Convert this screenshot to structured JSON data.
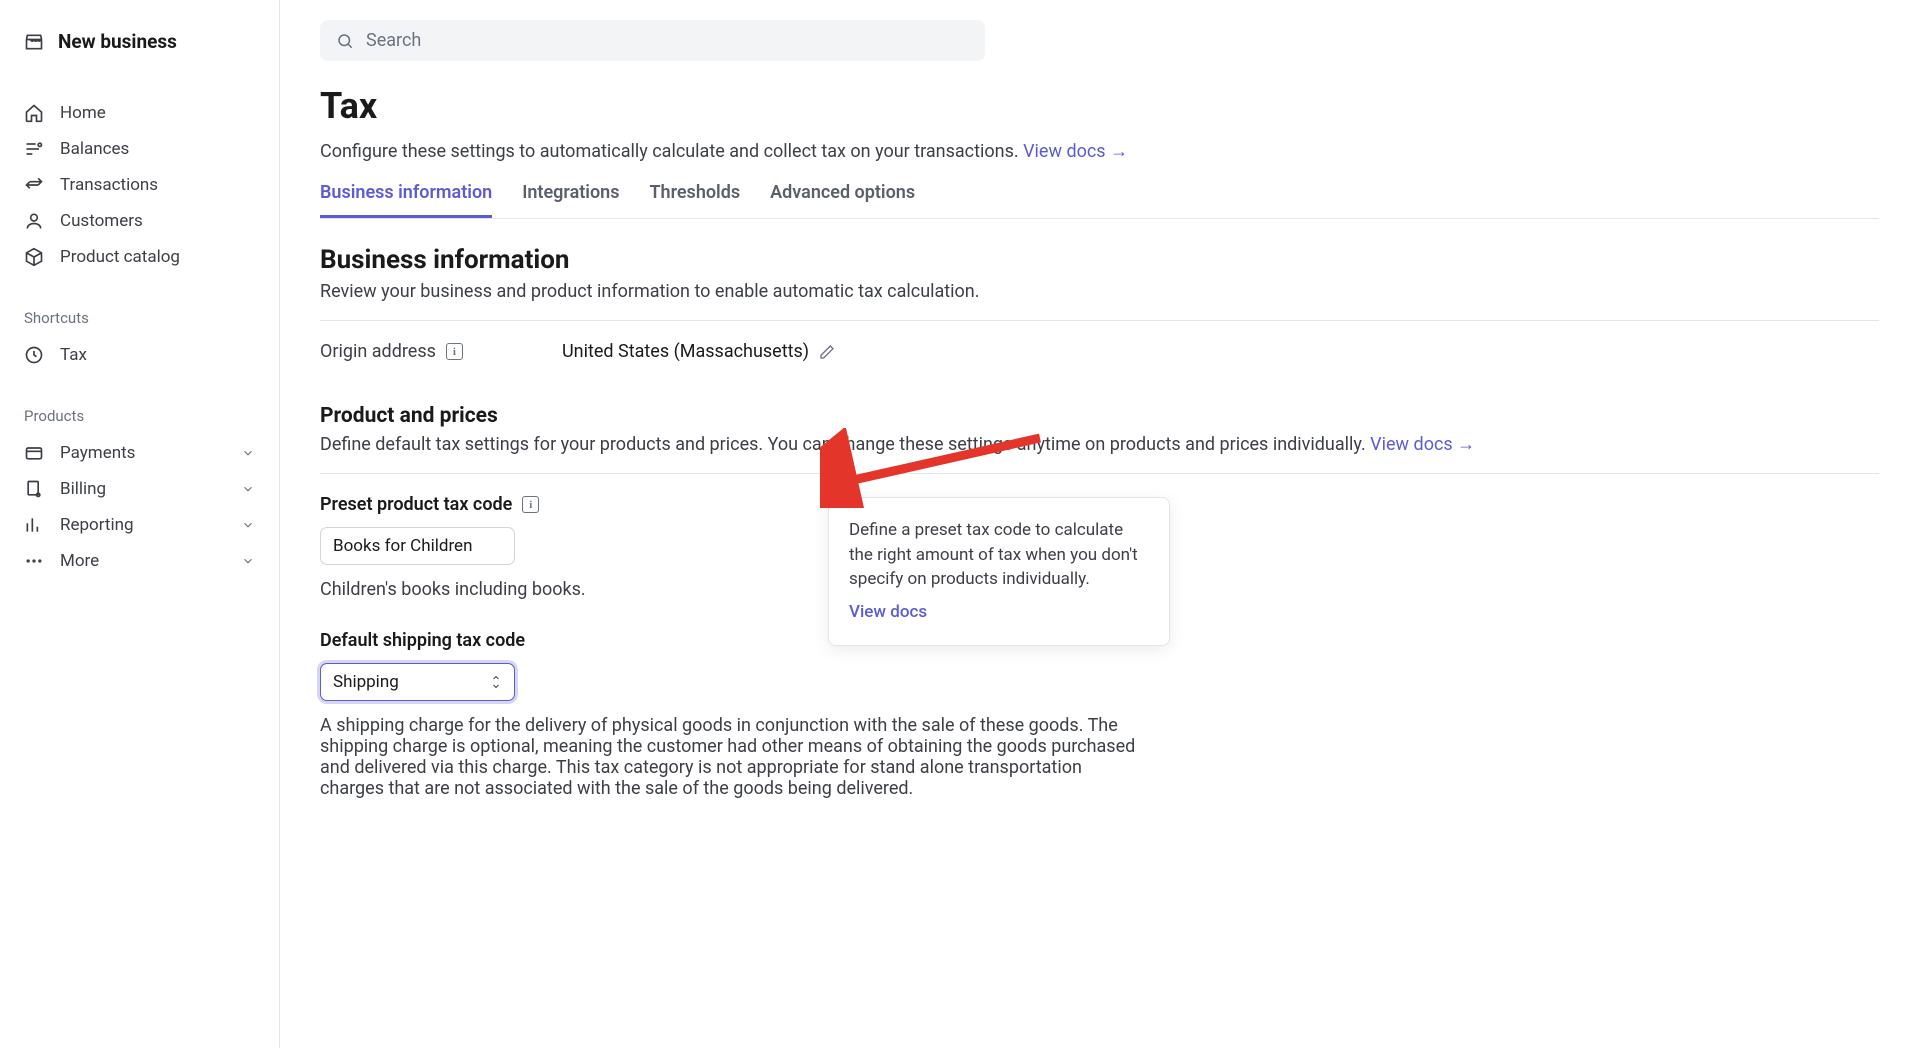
{
  "brand": "New business",
  "searchPlaceholder": "Search",
  "nav": {
    "main": [
      {
        "label": "Home"
      },
      {
        "label": "Balances"
      },
      {
        "label": "Transactions"
      },
      {
        "label": "Customers"
      },
      {
        "label": "Product catalog"
      }
    ],
    "shortcutsLabel": "Shortcuts",
    "shortcuts": [
      {
        "label": "Tax"
      }
    ],
    "productsLabel": "Products",
    "products": [
      {
        "label": "Payments"
      },
      {
        "label": "Billing"
      },
      {
        "label": "Reporting"
      },
      {
        "label": "More"
      }
    ]
  },
  "page": {
    "title": "Tax",
    "desc": "Configure these settings to automatically calculate and collect tax on your transactions. ",
    "viewDocs": "View docs"
  },
  "tabs": [
    "Business information",
    "Integrations",
    "Thresholds",
    "Advanced options"
  ],
  "bizInfo": {
    "title": "Business information",
    "desc": "Review your business and product information to enable automatic tax calculation.",
    "originLabel": "Origin address",
    "originValue": "United States (Massachusetts)"
  },
  "productPrices": {
    "title": "Product and prices",
    "desc": "Define default tax settings for your products and prices. You can change these settings anytime on products and prices individually. ",
    "viewDocs": "View docs"
  },
  "presetTax": {
    "label": "Preset product tax code",
    "value": "Books for Children",
    "desc": "Children's books including                                                                        books."
  },
  "tooltip": {
    "text": "Define a preset tax code to calculate the right amount of tax when you don't specify on products individually.",
    "link": "View docs"
  },
  "shippingTax": {
    "label": "Default shipping tax code",
    "value": "Shipping",
    "desc": "A shipping charge for the delivery of physical goods in conjunction with the sale of these goods. The shipping charge is optional, meaning the customer had other means of obtaining the goods purchased and delivered via this charge. This tax category is not appropriate for stand alone transportation charges that are not associated with the sale of the goods being delivered."
  }
}
